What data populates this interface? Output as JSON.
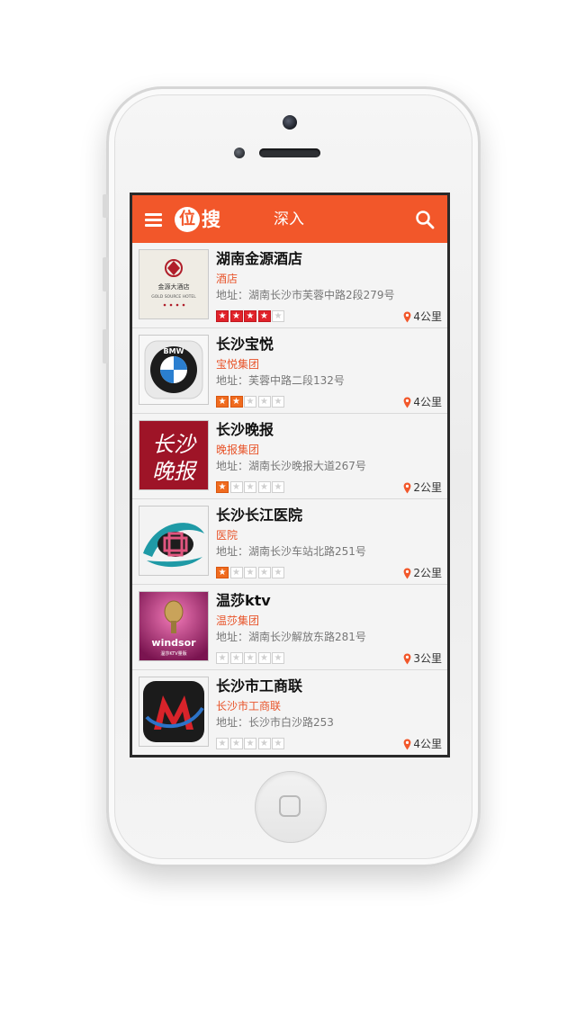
{
  "app": {
    "logo_char": "位",
    "logo_text": "搜",
    "title": "深入",
    "accent_color": "#f2572a"
  },
  "icons": {
    "menu": "hamburger-icon",
    "search": "search-icon",
    "location": "location-pin-icon"
  },
  "places": [
    {
      "name": "湖南金源酒店",
      "category": "酒店",
      "address": "地址：湖南长沙市芙蓉中路2段279号",
      "rating": 4,
      "star_color": "red",
      "distance": "4公里",
      "thumb": "gold-source-hotel-logo"
    },
    {
      "name": "长沙宝悦",
      "category": "宝悦集团",
      "address": "地址：芙蓉中路二段132号",
      "rating": 2,
      "star_color": "orange",
      "distance": "4公里",
      "thumb": "bmw-logo"
    },
    {
      "name": "长沙晚报",
      "category": "晚报集团",
      "address": "地址：湖南长沙晚报大道267号",
      "rating": 1,
      "star_color": "orange",
      "distance": "2公里",
      "thumb": "changsha-evening-news-logo"
    },
    {
      "name": "长沙长江医院",
      "category": "医院",
      "address": "地址：湖南长沙车站北路251号",
      "rating": 1,
      "star_color": "orange",
      "distance": "2公里",
      "thumb": "changjiang-hospital-logo"
    },
    {
      "name": "温莎ktv",
      "category": "温莎集团",
      "address": "地址：湖南长沙解放东路281号",
      "rating": 0,
      "star_color": "orange",
      "distance": "3公里",
      "thumb": "windsor-ktv-logo"
    },
    {
      "name": "长沙市工商联",
      "category": "长沙市工商联",
      "address": "地址：长沙市白沙路253",
      "rating": 0,
      "star_color": "orange",
      "distance": "4公里",
      "thumb": "federation-logo"
    }
  ],
  "thumb_text": {
    "hotel_cn": "金源大酒店",
    "hotel_en": "GOLD SOURCE HOTEL",
    "bmw": "BMW",
    "news_1": "长沙",
    "news_2": "晚报",
    "ktv_brand": "windsor",
    "ktv_sub": "温莎KTV量贩"
  }
}
